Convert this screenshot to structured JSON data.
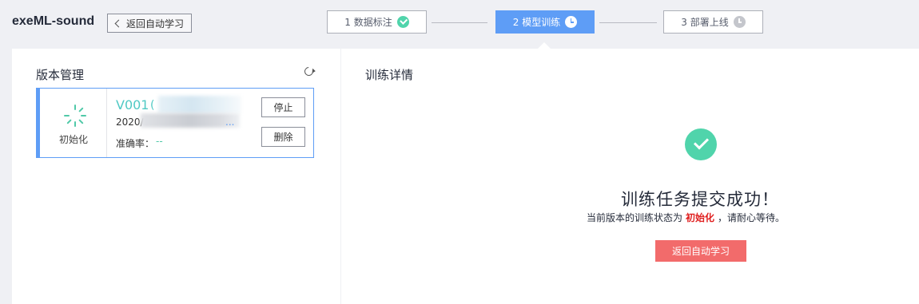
{
  "header": {
    "app_title": "exeML-sound",
    "back_label": "返回自动学习"
  },
  "steps": [
    {
      "label": "1 数据标注",
      "icon": "check-circle-icon",
      "state": "done"
    },
    {
      "label": "2 模型训练",
      "icon": "clock-icon",
      "state": "active"
    },
    {
      "label": "3 部署上线",
      "icon": "clock-icon",
      "state": "pending"
    }
  ],
  "left_panel": {
    "title": "版本管理",
    "version": {
      "name": "V001",
      "name_suffix": "(",
      "date_prefix": "2020/",
      "date_suffix": "...",
      "status": "初始化",
      "accuracy_label": "准确率：",
      "accuracy_value": "--",
      "stop_label": "停止",
      "delete_label": "删除"
    }
  },
  "right_panel": {
    "title": "训练详情",
    "success_title": "训练任务提交成功！",
    "sub_before": "当前版本的训练状态为",
    "sub_highlight": "初始化",
    "sub_after": "，请耐心等待。",
    "return_button": "返回自动学习"
  },
  "colors": {
    "accent": "#5e9df6",
    "success": "#50d4ab",
    "danger_button": "#f26b6b",
    "highlight_text": "#e02020"
  }
}
